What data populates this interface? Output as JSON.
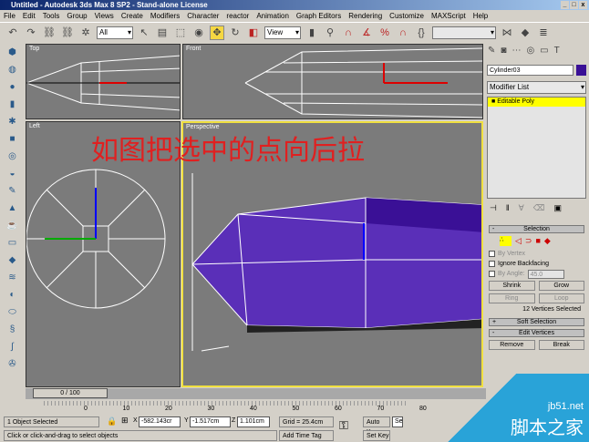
{
  "window": {
    "title": "Untitled - Autodesk 3ds Max 8 SP2  - Stand-alone License"
  },
  "menu": [
    "File",
    "Edit",
    "Tools",
    "Group",
    "Views",
    "Create",
    "Modifiers",
    "Character",
    "reactor",
    "Animation",
    "Graph Editors",
    "Rendering",
    "Customize",
    "MAXScript",
    "Help"
  ],
  "toolbar": {
    "selection_filter": "All",
    "ref_coord": "View",
    "named_selection": ""
  },
  "viewports": {
    "top": "Top",
    "front": "Front",
    "left": "Left",
    "perspective": "Perspective",
    "annotation": "如图把选中的点向后拉"
  },
  "panel": {
    "object_name": "Cylinder03",
    "object_color": "#3a1096",
    "modifier_list": "Modifier List",
    "stack_item": "Editable Poly",
    "selection": {
      "title": "Selection",
      "by_vertex": "By Vertex",
      "ignore_backfacing": "Ignore Backfacing",
      "by_angle": "By Angle:",
      "angle_value": "45.0",
      "shrink": "Shrink",
      "grow": "Grow",
      "ring": "Ring",
      "loop": "Loop",
      "status": "12 Vertices Selected"
    },
    "soft_selection": "Soft Selection",
    "edit_vertices": "Edit Vertices",
    "remove": "Remove",
    "break": "Break"
  },
  "timeline": {
    "frame": "0 / 100",
    "ticks": [
      "0",
      "10",
      "20",
      "30",
      "40",
      "50",
      "60",
      "70",
      "80"
    ]
  },
  "status": {
    "selected": "1 Object Selected",
    "prompt": "Click or click-and-drag to select objects",
    "x": "-582.143cr",
    "y": "-1.517cm",
    "z": "1.101cm",
    "grid": "Grid = 25.4cm",
    "add_time_tag": "Add Time Tag",
    "auto_key": "Auto Key",
    "set_key": "Set Key",
    "key_filter": "Se"
  },
  "watermark": {
    "site": "jb51.net",
    "name": "脚本之家"
  }
}
